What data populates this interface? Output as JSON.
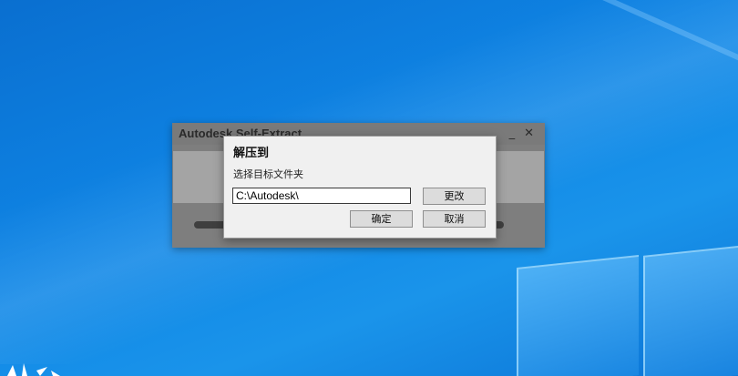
{
  "desktop": {
    "accent": "#0f86e6"
  },
  "background_window": {
    "title": "Autodesk Self-Extract",
    "minimize_glyph": "_",
    "close_glyph": "✕"
  },
  "dialog": {
    "title": "解压到",
    "subtitle": "选择目标文件夹",
    "path_value": "C:\\Autodesk\\",
    "change_label": "更改",
    "ok_label": "确定",
    "cancel_label": "取消"
  },
  "icons": {
    "minimize": "minimize-icon",
    "close": "close-icon"
  }
}
